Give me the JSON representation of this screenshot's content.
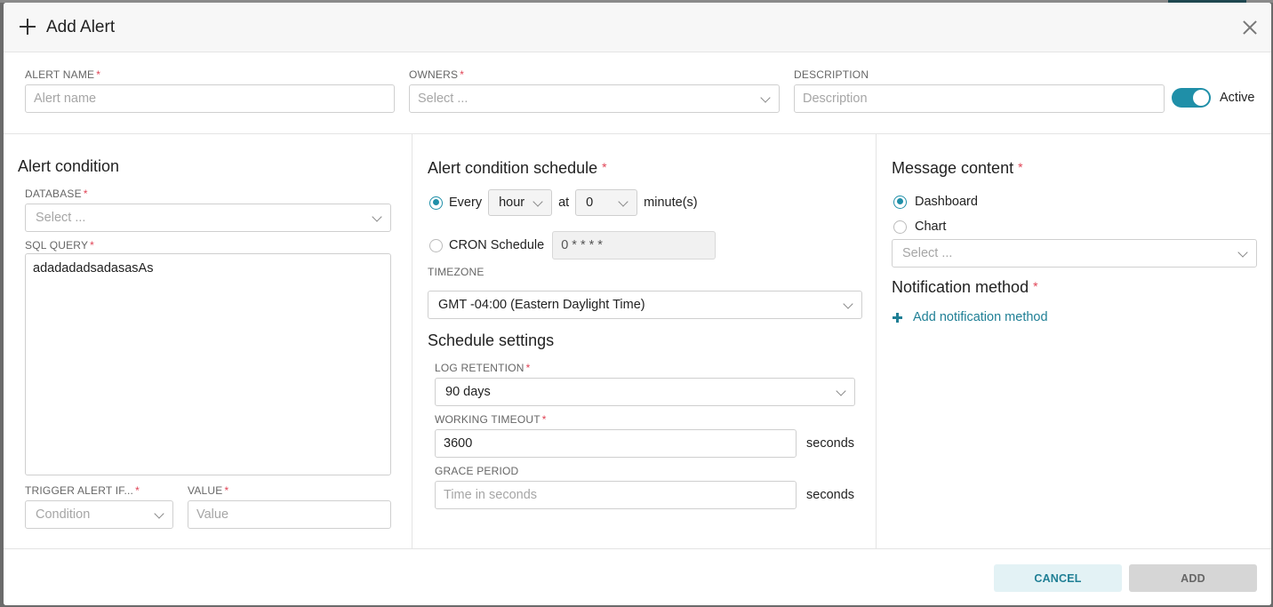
{
  "dialog": {
    "title": "Add Alert"
  },
  "top": {
    "alert_name": {
      "label": "ALERT NAME",
      "required": "*",
      "placeholder": "Alert name"
    },
    "owners": {
      "label": "OWNERS",
      "required": "*",
      "placeholder": "Select ..."
    },
    "description": {
      "label": "DESCRIPTION",
      "placeholder": "Description"
    },
    "active": {
      "label": "Active",
      "state": "on"
    }
  },
  "condition": {
    "title": "Alert condition",
    "database": {
      "label": "DATABASE",
      "required": "*",
      "placeholder": "Select ..."
    },
    "sql_query": {
      "label": "SQL QUERY",
      "required": "*",
      "value": "adadadadsadasasAs"
    },
    "trigger": {
      "label": "TRIGGER ALERT IF...",
      "required": "*",
      "placeholder": "Condition"
    },
    "value": {
      "label": "VALUE",
      "required": "*",
      "placeholder": "Value"
    }
  },
  "schedule": {
    "title": "Alert condition schedule",
    "required": "*",
    "every_label": "Every",
    "unit_value": "hour",
    "at_label": "at",
    "minute_value": "0",
    "minutes_label": "minute(s)",
    "cron_label": "CRON Schedule",
    "cron_value": "0 * * * *",
    "timezone_label": "TIMEZONE",
    "timezone_value": "GMT -04:00 (Eastern Daylight Time)",
    "settings_title": "Schedule settings",
    "log_retention": {
      "label": "LOG RETENTION",
      "required": "*",
      "value": "90 days"
    },
    "working_timeout": {
      "label": "WORKING TIMEOUT",
      "required": "*",
      "value": "3600",
      "unit": "seconds"
    },
    "grace_period": {
      "label": "GRACE PERIOD",
      "placeholder": "Time in seconds",
      "unit": "seconds"
    }
  },
  "message": {
    "title": "Message content",
    "required": "*",
    "option_dashboard": "Dashboard",
    "option_chart": "Chart",
    "select_placeholder": "Select ...",
    "notification_title": "Notification method",
    "add_notification": "Add notification method"
  },
  "footer": {
    "cancel": "CANCEL",
    "add": "ADD"
  },
  "colors": {
    "accent": "#1f8fa8",
    "required": "#e04355"
  }
}
